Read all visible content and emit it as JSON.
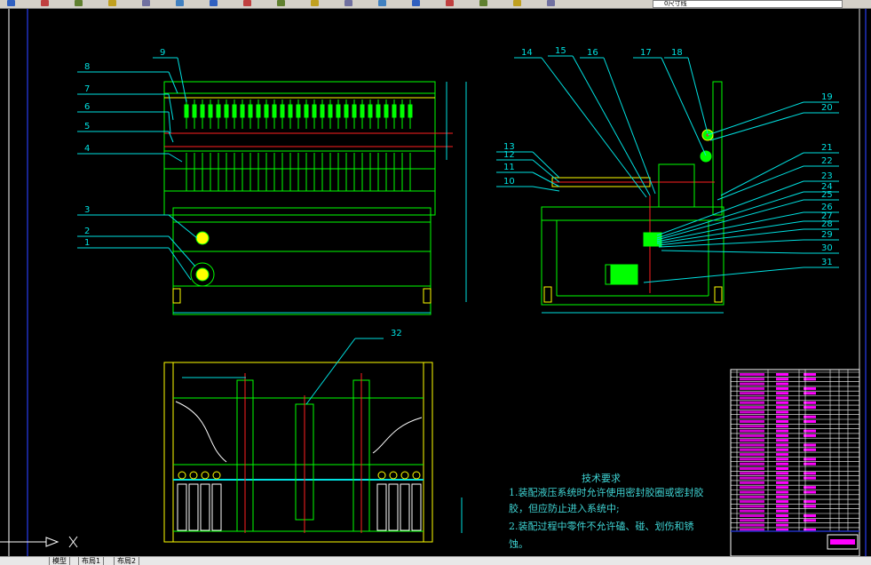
{
  "toolbar": {
    "layer_name": "0尺寸线",
    "icons": [
      "pan-icon",
      "zoom-icon",
      "properties-icon",
      "match-icon",
      "cut-icon",
      "copy-icon",
      "paste-icon",
      "undo-icon",
      "redo-icon",
      "zoom-realtime-icon",
      "zoom-window-icon",
      "zoom-previous-icon",
      "text-style-icon",
      "dim-style-icon",
      "table-icon",
      "help-icon",
      "layer-icon"
    ]
  },
  "colors": {
    "background": "#000000",
    "frame": "#00ff00",
    "accent_yellow": "#ffff00",
    "leader": "#00e0e0",
    "centerline": "#ff2020",
    "title_block_text": "#ff00ff",
    "tech_text": "#3fd4d4"
  },
  "drawing": {
    "balloons": [
      "1",
      "2",
      "3",
      "4",
      "5",
      "6",
      "7",
      "8",
      "9",
      "10",
      "11",
      "12",
      "13",
      "14",
      "15",
      "16",
      "17",
      "18",
      "19",
      "20",
      "21",
      "22",
      "23",
      "24",
      "25",
      "26",
      "27",
      "28",
      "29",
      "30",
      "31",
      "32"
    ]
  },
  "tech_requirements": {
    "title": "技术要求",
    "lines": [
      "1.装配液压系统时允许使用密封胶圈或密封胶",
      "胶，但应防止进入系统中;",
      "2.装配过程中零件不允许磕、碰、划伤和锈",
      "蚀。"
    ]
  },
  "ucs": {
    "x_label": "X"
  },
  "tabs": [
    "模型",
    "布局1",
    "布局2"
  ]
}
